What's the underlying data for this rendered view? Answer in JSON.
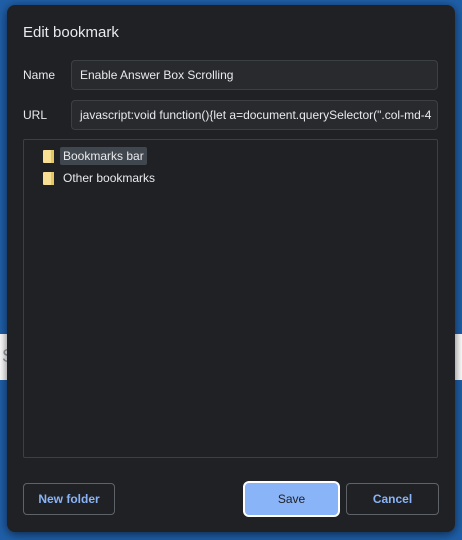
{
  "background": {
    "page_letter": "S"
  },
  "dialog": {
    "title": "Edit bookmark",
    "name_label": "Name",
    "name_value": "Enable Answer Box Scrolling",
    "url_label": "URL",
    "url_value": "javascript:void function(){let a=document.querySelector(\".col-md-4",
    "folders": [
      {
        "label": "Bookmarks bar",
        "icon": "folder-icon",
        "selected": true
      },
      {
        "label": "Other bookmarks",
        "icon": "folder-icon",
        "selected": false
      }
    ],
    "new_folder_label": "New folder",
    "save_label": "Save",
    "cancel_label": "Cancel"
  },
  "colors": {
    "dialog_bg": "#202124",
    "accent": "#8ab4f8",
    "folder": "#f7e093",
    "page_bg": "#1f5fa8"
  }
}
